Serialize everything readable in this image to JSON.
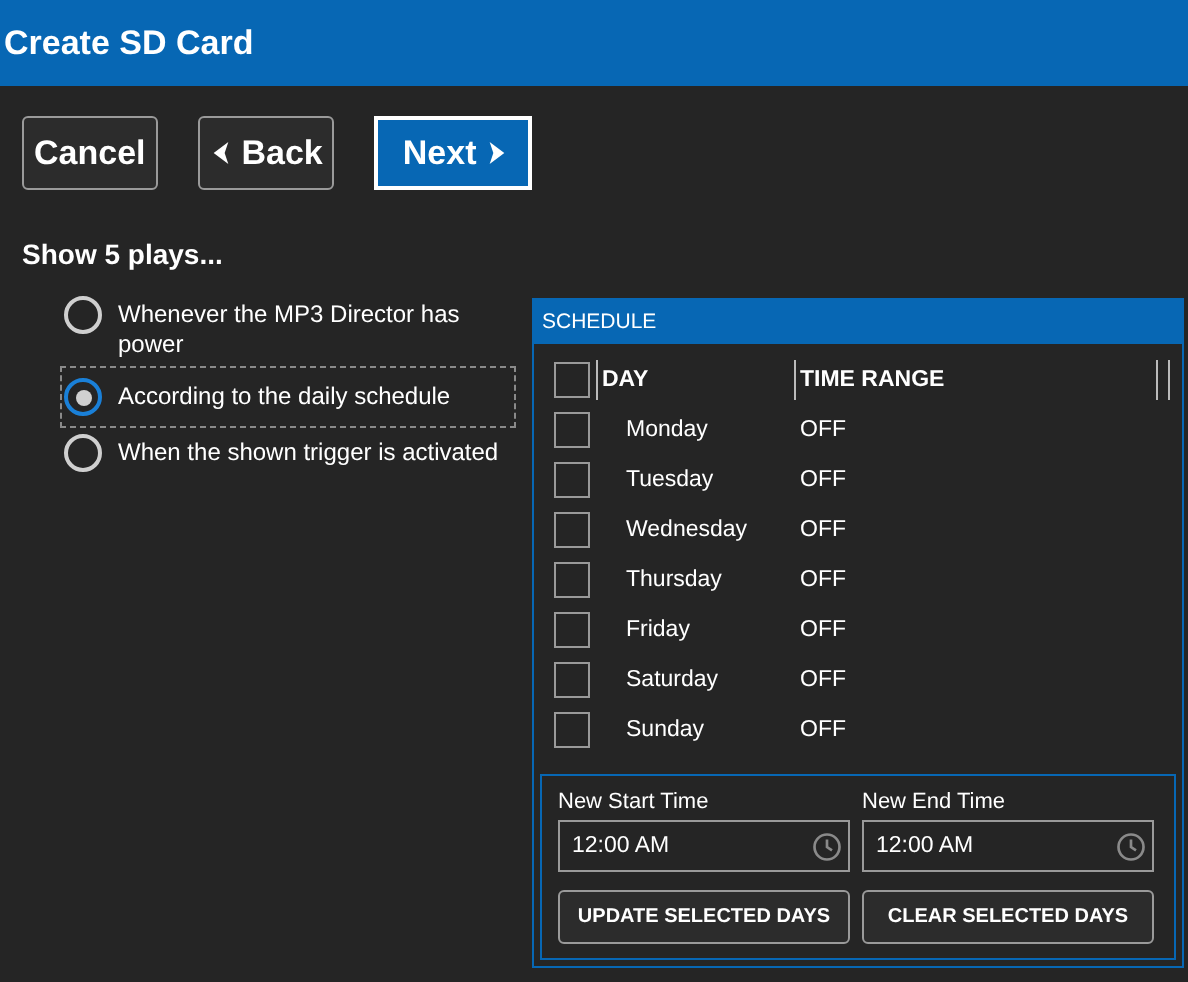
{
  "window": {
    "title": "Create SD Card"
  },
  "nav_buttons": [
    {
      "label": "Cancel",
      "kind": "cancel"
    },
    {
      "label": "Back",
      "kind": "back"
    },
    {
      "label": "Next",
      "kind": "next"
    }
  ],
  "heading": "Show 5 plays...",
  "options": [
    {
      "label": "Whenever the MP3 Director has power",
      "selected": false
    },
    {
      "label": "According to the daily schedule",
      "selected": true
    },
    {
      "label": "When the shown trigger is activated",
      "selected": false
    }
  ],
  "schedule": {
    "title": "SCHEDULE",
    "select_all_checked": false,
    "columns": [
      "DAY",
      "TIME RANGE"
    ],
    "rows": [
      {
        "day": "Monday",
        "time_range": "OFF",
        "checked": false
      },
      {
        "day": "Tuesday",
        "time_range": "OFF",
        "checked": false
      },
      {
        "day": "Wednesday",
        "time_range": "OFF",
        "checked": false
      },
      {
        "day": "Thursday",
        "time_range": "OFF",
        "checked": false
      },
      {
        "day": "Friday",
        "time_range": "OFF",
        "checked": false
      },
      {
        "day": "Saturday",
        "time_range": "OFF",
        "checked": false
      },
      {
        "day": "Sunday",
        "time_range": "OFF",
        "checked": false
      }
    ],
    "start": {
      "label": "New Start Time",
      "value": "12:00 AM"
    },
    "end": {
      "label": "New End Time",
      "value": "12:00 AM"
    },
    "buttons": [
      "UPDATE SELECTED DAYS",
      "CLEAR SELECTED DAYS"
    ]
  }
}
